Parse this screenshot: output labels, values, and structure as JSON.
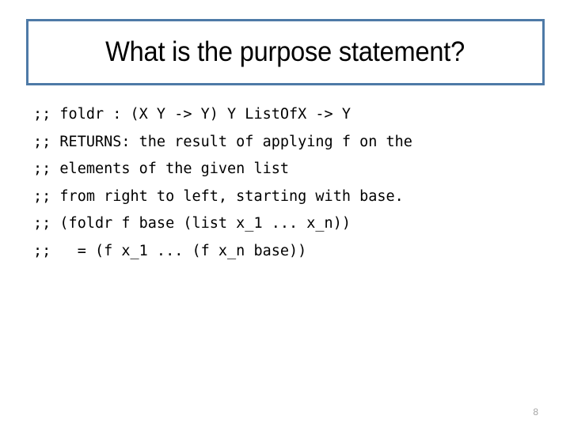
{
  "slide": {
    "background_color": "#ffffff",
    "title": {
      "text": "What is the purpose statement?",
      "border_color": "#4e7aa7",
      "text_color": "#000000"
    },
    "code_block": {
      "text_color": "#000000",
      "lines": [
        ";; foldr : (X Y -> Y) Y ListOfX -> Y",
        ";; RETURNS: the result of applying f on the",
        ";; elements of the given list",
        ";; from right to left, starting with base.",
        ";; (foldr f base (list x_1 ... x_n))",
        ";;   = (f x_1 ... (f x_n base))"
      ]
    },
    "page_number": {
      "value": "8",
      "color": "#a6a6a6"
    }
  }
}
